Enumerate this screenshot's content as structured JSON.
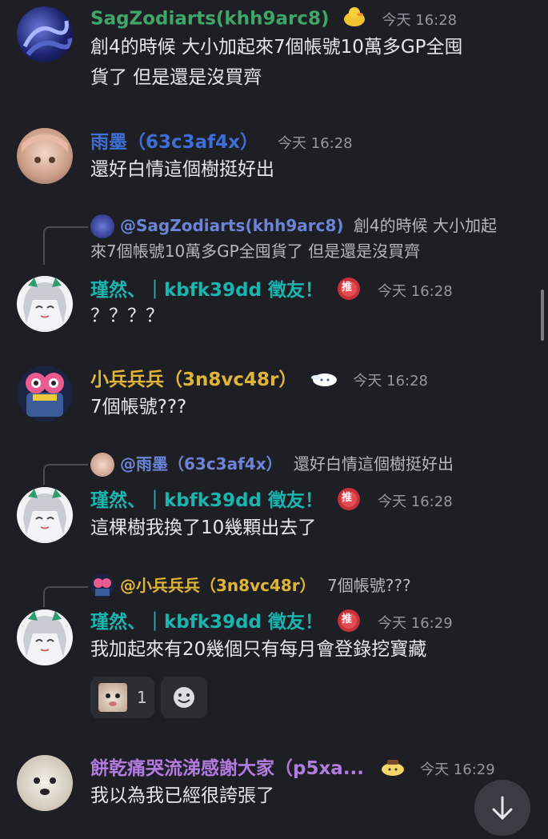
{
  "colors": {
    "background": "#1e1f24",
    "green_name": "#3fa66a",
    "blue_name": "#3e6fd8",
    "teal_name": "#19b6b0",
    "gold_name": "#e0b536",
    "purple_name": "#b27be0",
    "time": "#9597a0"
  },
  "messages": [
    {
      "name": "SagZodiarts(khh9arc8)",
      "time": "今天 16:28",
      "lines": [
        "創4的時候 大小加起來7個帳號10萬多GP全囤",
        "貨了 但是還是沒買齊"
      ],
      "badge_icon": "duck-emoji-icon"
    },
    {
      "name": "雨墨（63c3af4x）",
      "time": "今天 16:28",
      "lines": [
        "還好白情這個樹挺好出"
      ]
    },
    {
      "reply": {
        "name": "@SagZodiarts(khh9arc8)",
        "lines": [
          "創4的時候 大小加起",
          "來7個帳號10萬多GP全囤貨了 但是還是沒買齊"
        ]
      },
      "name": "瑾然、｜kbfk39dd 徵友！",
      "time": "今天 16:28",
      "lines": [
        "？？？？"
      ],
      "badge_text": "推"
    },
    {
      "name": "小兵兵兵（3n8vc48r）",
      "time": "今天 16:28",
      "lines": [
        "7個帳號???"
      ],
      "badge_icon": "cinnamoroll-icon"
    },
    {
      "reply": {
        "name": "@雨墨（63c3af4x）",
        "lines": [
          "還好白情這個樹挺好出"
        ]
      },
      "name": "瑾然、｜kbfk39dd 徵友！",
      "time": "今天 16:28",
      "lines": [
        "這棵樹我換了10幾顆出去了"
      ],
      "badge_text": "推"
    },
    {
      "reply": {
        "name": "@小兵兵兵（3n8vc48r）",
        "lines": [
          "7個帳號???"
        ]
      },
      "name": "瑾然、｜kbfk39dd 徵友！",
      "time": "今天 16:29",
      "lines": [
        "我加起來有20幾個只有每月會登錄挖寶藏"
      ],
      "badge_text": "推",
      "reaction": {
        "count": "1"
      }
    },
    {
      "name": "餅乾痛哭流涕感謝大家（p5xa...",
      "time": "今天 16:29",
      "lines": [
        "我以為我已經很誇張了"
      ],
      "badge_icon": "pompompurin-icon"
    }
  ]
}
